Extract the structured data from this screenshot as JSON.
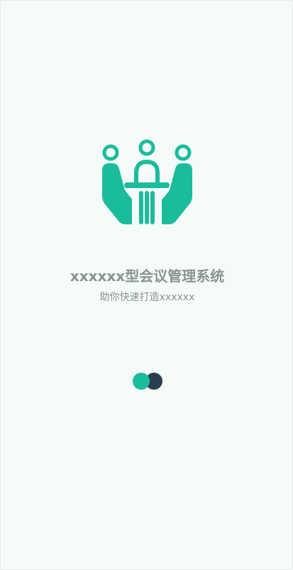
{
  "splash": {
    "title": "xxxxxx型会议管理系统",
    "subtitle": "助你快速打造xxxxxx",
    "logo_icon": "meeting-table-icon",
    "loader_icon": "loading-dots-icon"
  },
  "colors": {
    "background": "#f4fbf8",
    "accent": "#1abc9c",
    "dark": "#2c3e50",
    "text": "#8b9391"
  }
}
